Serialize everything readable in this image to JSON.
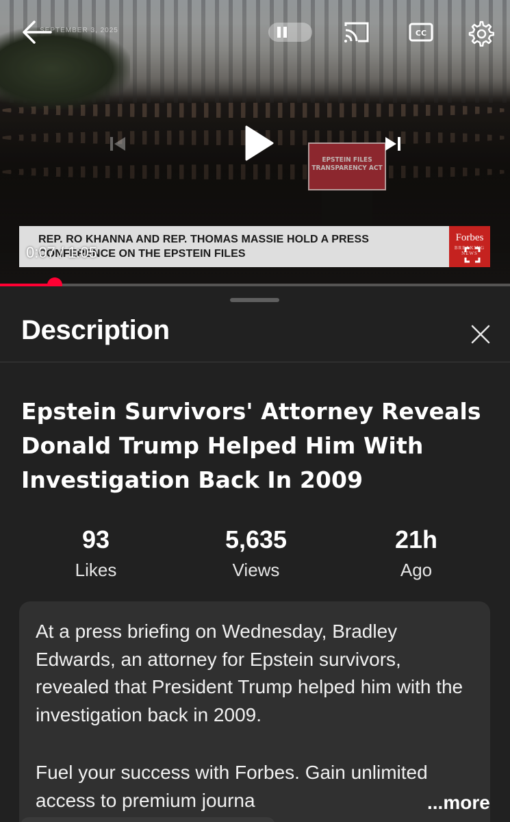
{
  "player": {
    "date_stamp": "SEPTEMBER 3, 2025",
    "podium_sign": "EPSTEIN FILES\nTRANSPARENCY ACT",
    "lower_third_text": "REP. RO KHANNA AND REP. THOMAS MASSIE HOLD A PRESS CONFERENCE ON THE EPSTEIN FILES",
    "brand_name": "Forbes",
    "brand_sub": "BREAKING NEWS",
    "current_time": "0:07",
    "duration": "1:05",
    "time_display": "0:07 / 1:05",
    "progress_fraction": 0.108,
    "accent_color": "#ff0033",
    "icons": [
      "back-arrow-icon",
      "pause-icon",
      "cast-icon",
      "closed-captions-icon",
      "settings-gear-icon",
      "previous-icon",
      "play-icon",
      "next-icon",
      "fullscreen-icon"
    ]
  },
  "sheet": {
    "title": "Description",
    "close_icon": "close-icon",
    "video_title": "Epstein Survivors' Attorney Reveals Donald Trump Helped Him With Investigation Back In 2009",
    "stats": {
      "likes": {
        "value": "93",
        "label": "Likes"
      },
      "views": {
        "value": "5,635",
        "label": "Views"
      },
      "ago": {
        "value": "21h",
        "label": "Ago"
      }
    },
    "description": {
      "paragraph1": "At a press briefing on Wednesday, Bradley Edwards, an attorney for Epstein survivors, revealed that President Trump helped him with the investigation back in 2009.",
      "paragraph2": "Fuel your success with Forbes. Gain unlimited access to premium journa",
      "more_label": "...more"
    }
  }
}
